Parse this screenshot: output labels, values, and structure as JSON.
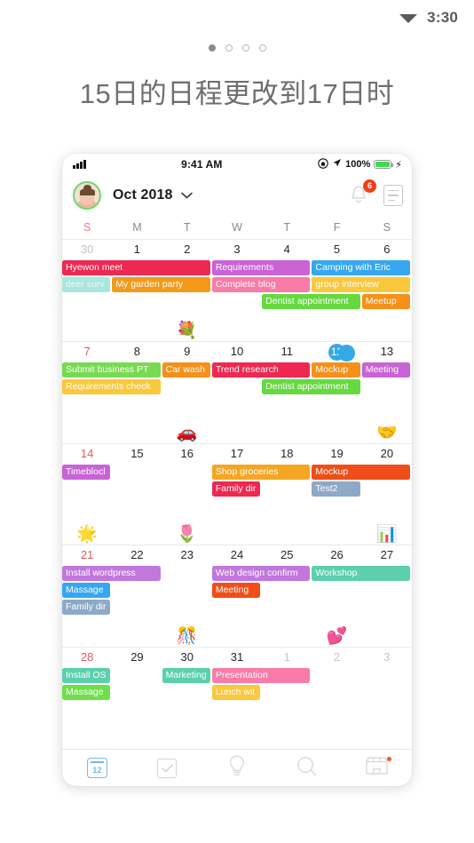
{
  "os_status": {
    "wifi_icon": "wifi-icon",
    "time": "3:30"
  },
  "pager": {
    "count": 4,
    "active_index": 0
  },
  "headline": "15日的日程更改到17日时",
  "phone": {
    "status_bar": {
      "signal_icon": "signal-bars-icon",
      "time": "9:41 AM",
      "rotation_lock_icon": "rotation-lock-icon",
      "location_icon": "location-arrow-icon",
      "battery_percent": "100%",
      "battery_icon": "battery-icon",
      "charging_icon": "lightning-bolt-icon"
    },
    "header": {
      "avatar": "user-avatar",
      "month_label": "Oct 2018",
      "chevron_icon": "chevron-down-icon",
      "bell_icon": "bell-icon",
      "notification_count": "6",
      "agenda_icon": "agenda-list-icon"
    },
    "weekdays": [
      {
        "label": "S",
        "weekend": true
      },
      {
        "label": "M",
        "weekend": false
      },
      {
        "label": "T",
        "weekend": false
      },
      {
        "label": "W",
        "weekend": false
      },
      {
        "label": "T",
        "weekend": false
      },
      {
        "label": "F",
        "weekend": false
      },
      {
        "label": "S",
        "weekend": false
      }
    ],
    "weeks": [
      {
        "days": [
          {
            "num": "30",
            "style": "dim-sun"
          },
          {
            "num": "1",
            "style": ""
          },
          {
            "num": "2",
            "style": ""
          },
          {
            "num": "3",
            "style": ""
          },
          {
            "num": "4",
            "style": ""
          },
          {
            "num": "5",
            "style": ""
          },
          {
            "num": "6",
            "style": ""
          }
        ],
        "events": [
          [
            {
              "title": "Hyewon meet",
              "start": 0,
              "span": 3,
              "color": "#ee2851"
            },
            {
              "title": "Requirements",
              "start": 3,
              "span": 2,
              "color": "#c963d6"
            },
            {
              "title": "Camping with Eric",
              "start": 5,
              "span": 2,
              "color": "#36a7f0"
            }
          ],
          [
            {
              "title": "deer surv",
              "start": 0,
              "span": 1,
              "color": "#a9e6dd",
              "faded": true
            },
            {
              "title": "My garden party",
              "start": 1,
              "span": 2,
              "color": "#f49a18"
            },
            {
              "title": "Complete blog",
              "start": 3,
              "span": 2,
              "color": "#f97ba8"
            },
            {
              "title": "group interview",
              "start": 5,
              "span": 2,
              "color": "#fac83c"
            }
          ],
          [
            {
              "title": "Dentist appointment",
              "start": 4,
              "span": 2,
              "color": "#65d93f"
            },
            {
              "title": "Meetup",
              "start": 6,
              "span": 1,
              "color": "#f59019"
            }
          ]
        ],
        "emojis": [
          {
            "glyph": "💐",
            "col": 2
          }
        ]
      },
      {
        "days": [
          {
            "num": "7",
            "style": "sun"
          },
          {
            "num": "8",
            "style": ""
          },
          {
            "num": "9",
            "style": ""
          },
          {
            "num": "10",
            "style": ""
          },
          {
            "num": "11",
            "style": ""
          },
          {
            "num": "12",
            "style": "today",
            "marker": true
          },
          {
            "num": "13",
            "style": ""
          }
        ],
        "events": [
          [
            {
              "title": "Submit business PT",
              "start": 0,
              "span": 2,
              "color": "#78da53"
            },
            {
              "title": "Car wash",
              "start": 2,
              "span": 1,
              "color": "#f59019"
            },
            {
              "title": "Trend research",
              "start": 3,
              "span": 2,
              "color": "#ee2851"
            },
            {
              "title": "Mockup",
              "start": 5,
              "span": 1,
              "color": "#f59019"
            },
            {
              "title": "Meeting",
              "start": 6,
              "span": 1,
              "color": "#c963d6"
            }
          ],
          [
            {
              "title": "Requirements check",
              "start": 0,
              "span": 2,
              "color": "#fac83c"
            },
            {
              "title": "Dentist appointment",
              "start": 4,
              "span": 2,
              "color": "#65d93f"
            }
          ]
        ],
        "emojis": [
          {
            "glyph": "🚗",
            "col": 2
          },
          {
            "glyph": "🤝",
            "col": 6
          }
        ]
      },
      {
        "days": [
          {
            "num": "14",
            "style": "sun"
          },
          {
            "num": "15",
            "style": ""
          },
          {
            "num": "16",
            "style": ""
          },
          {
            "num": "17",
            "style": ""
          },
          {
            "num": "18",
            "style": ""
          },
          {
            "num": "19",
            "style": ""
          },
          {
            "num": "20",
            "style": ""
          }
        ],
        "events": [
          [
            {
              "title": "Timeblocl",
              "start": 0,
              "span": 1,
              "color": "#c963d6"
            },
            {
              "title": "Shop groceries",
              "start": 3,
              "span": 2,
              "color": "#f5a623"
            },
            {
              "title": "Mockup",
              "start": 5,
              "span": 2,
              "color": "#f04e18"
            }
          ],
          [
            {
              "title": "Family dir",
              "start": 3,
              "span": 1,
              "color": "#ee2851"
            },
            {
              "title": "Test2",
              "start": 5,
              "span": 1,
              "color": "#8ea9c8"
            }
          ]
        ],
        "emojis": [
          {
            "glyph": "🌟",
            "col": 0
          },
          {
            "glyph": "🌷",
            "col": 2
          },
          {
            "glyph": "📊",
            "col": 6
          }
        ]
      },
      {
        "days": [
          {
            "num": "21",
            "style": "sun"
          },
          {
            "num": "22",
            "style": ""
          },
          {
            "num": "23",
            "style": ""
          },
          {
            "num": "24",
            "style": ""
          },
          {
            "num": "25",
            "style": ""
          },
          {
            "num": "26",
            "style": ""
          },
          {
            "num": "27",
            "style": ""
          }
        ],
        "events": [
          [
            {
              "title": "Install wordpress",
              "start": 0,
              "span": 2,
              "color": "#c277dd"
            },
            {
              "title": "Web design confirm",
              "start": 3,
              "span": 2,
              "color": "#c277dd"
            },
            {
              "title": "Workshop",
              "start": 5,
              "span": 2,
              "color": "#5ccfad"
            }
          ],
          [
            {
              "title": "Massage",
              "start": 0,
              "span": 1,
              "color": "#36a7f0"
            },
            {
              "title": "Meeting",
              "start": 3,
              "span": 1,
              "color": "#f04e18"
            }
          ],
          [
            {
              "title": "Family dir",
              "start": 0,
              "span": 1,
              "color": "#8ea9c8"
            }
          ]
        ],
        "emojis": [
          {
            "glyph": "🎊",
            "col": 2
          },
          {
            "glyph": "💕",
            "col": 5
          }
        ]
      },
      {
        "days": [
          {
            "num": "28",
            "style": "sun"
          },
          {
            "num": "29",
            "style": ""
          },
          {
            "num": "30",
            "style": ""
          },
          {
            "num": "31",
            "style": ""
          },
          {
            "num": "1",
            "style": "dim"
          },
          {
            "num": "2",
            "style": "dim"
          },
          {
            "num": "3",
            "style": "dim"
          }
        ],
        "events": [
          [
            {
              "title": "Install OS",
              "start": 0,
              "span": 1,
              "color": "#5ccfad"
            },
            {
              "title": "Marketing",
              "start": 2,
              "span": 1,
              "color": "#5ccfad"
            },
            {
              "title": "Presentation",
              "start": 3,
              "span": 2,
              "color": "#f97ba8"
            }
          ],
          [
            {
              "title": "Massage",
              "start": 0,
              "span": 1,
              "color": "#6fe04c"
            },
            {
              "title": "Lunch wit",
              "start": 3,
              "span": 1,
              "color": "#fac83c"
            }
          ]
        ],
        "emojis": []
      }
    ],
    "bottom_nav": [
      {
        "icon": "calendar-icon",
        "label": "12",
        "active": true,
        "badge": false
      },
      {
        "icon": "checkbox-icon",
        "label": "",
        "active": false,
        "badge": false
      },
      {
        "icon": "lightbulb-icon",
        "label": "",
        "active": false,
        "badge": false
      },
      {
        "icon": "search-icon",
        "label": "",
        "active": false,
        "badge": false
      },
      {
        "icon": "store-icon",
        "label": "",
        "active": false,
        "badge": true
      }
    ]
  },
  "colors": {
    "accent_blue": "#34a9e8",
    "badge_red": "#f03e18",
    "sunday_red": "#e05a5a",
    "avatar_ring": "#6ed86e"
  }
}
